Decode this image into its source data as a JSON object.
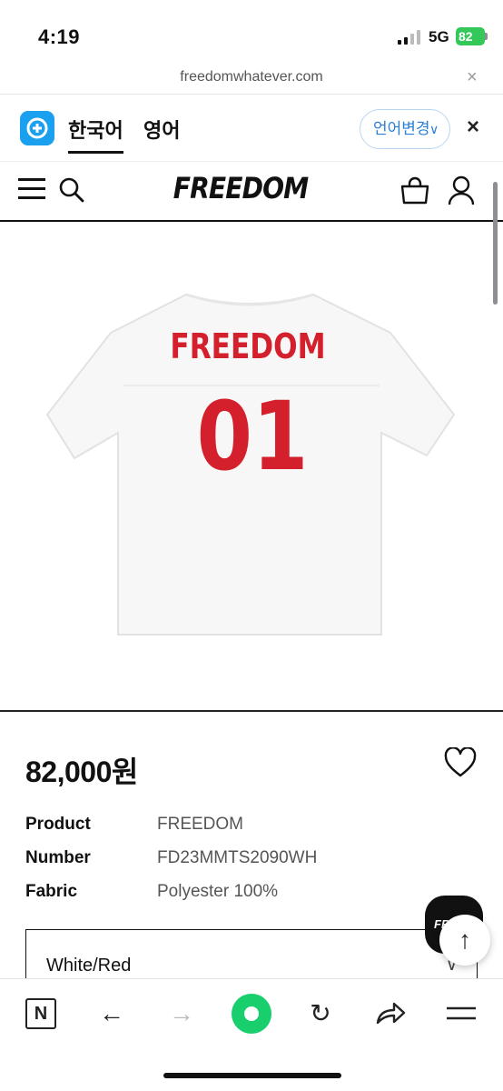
{
  "status": {
    "time": "4:19",
    "network": "5G",
    "battery": "82"
  },
  "browser": {
    "url": "freedomwhatever.com",
    "close_symbol": "×"
  },
  "translate": {
    "lang_current": "한국어",
    "lang_other": "영어",
    "change_label": "언어변경",
    "close_symbol": "×"
  },
  "site": {
    "brand": "FREEDOM"
  },
  "product": {
    "price": "82,000원",
    "specs": [
      {
        "key": "Product",
        "value": "FREEDOM"
      },
      {
        "key": "Number",
        "value": "FD23MMTS2090WH"
      },
      {
        "key": "Fabric",
        "value": "Polyester 100%"
      }
    ],
    "option_selected": "White/Red",
    "image": {
      "back_print": "FREEDOM",
      "number": "01",
      "print_color": "#d4202c"
    }
  },
  "floating": {
    "brand_badge": "FR",
    "top_symbol": "↑"
  },
  "toolbar": {
    "n_label": "N",
    "back": "←",
    "forward": "→",
    "reload": "↻"
  },
  "colors": {
    "accent_green": "#19cf6d",
    "translate_blue": "#1ba0f0",
    "battery_green": "#34c759"
  }
}
